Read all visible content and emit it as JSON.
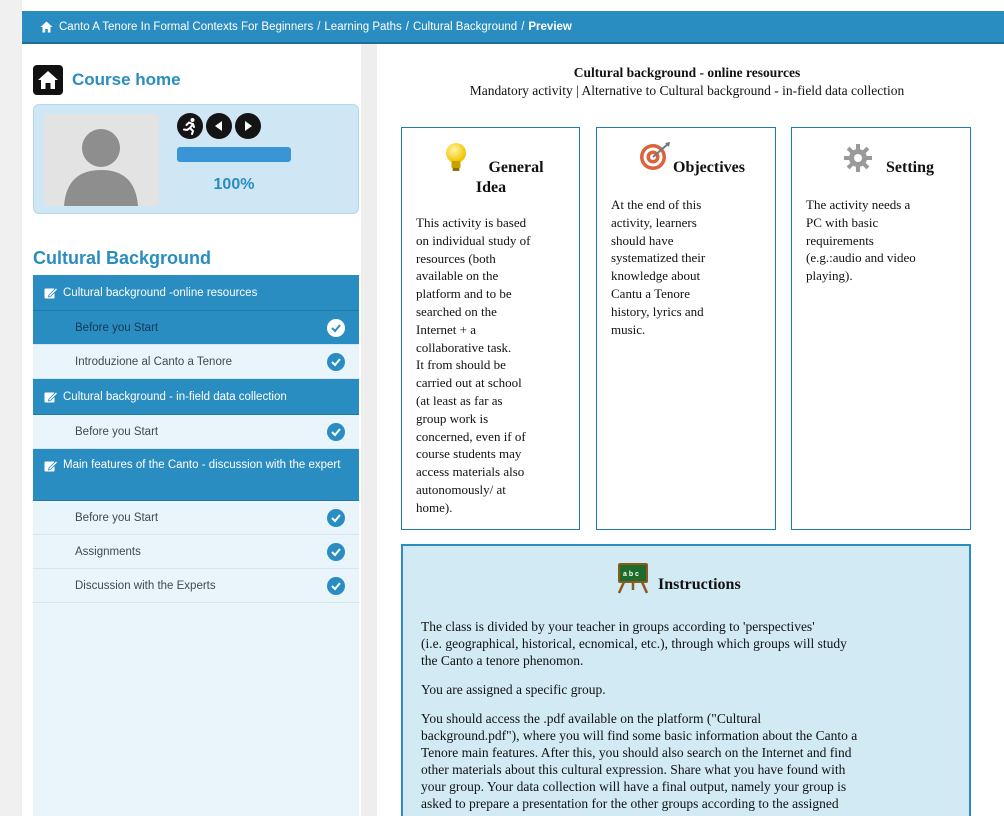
{
  "breadcrumb": {
    "items": [
      "Canto A Tenore In Formal Contexts For Beginners",
      "Learning Paths",
      "Cultural Background"
    ],
    "separator": "/",
    "current": "Preview"
  },
  "sidebar": {
    "course_home": "Course home",
    "progress": {
      "percent_label": "100%",
      "fraction": 1.0
    },
    "section_title": "Cultural Background",
    "groups": [
      {
        "title": "Cultural background -online resources",
        "items": [
          {
            "label": "Before you Start",
            "active": true,
            "completed": true
          },
          {
            "label": "Introduzione al Canto a Tenore",
            "active": false,
            "completed": true
          }
        ]
      },
      {
        "title": "Cultural background - in-field data collection",
        "items": [
          {
            "label": "Before you Start",
            "active": false,
            "completed": true
          }
        ]
      },
      {
        "title": "Main features of the Canto - discussion with the expert",
        "items": [
          {
            "label": "Before you Start",
            "active": false,
            "completed": true
          },
          {
            "label": "Assignments",
            "active": false,
            "completed": true
          },
          {
            "label": "Discussion with the Experts",
            "active": false,
            "completed": true
          }
        ]
      }
    ]
  },
  "activity": {
    "title": "Cultural background - online resources",
    "subtitle": "Mandatory activity | Alternative to Cultural background - in-field data collection"
  },
  "cards": {
    "idea": {
      "icon": "lightbulb-icon",
      "title_line1": "General",
      "title_line2": "Idea",
      "lines": [
        "This activity is based",
        "on individual study of",
        "resources (both",
        "available on the",
        "platform and to be",
        "searched on the",
        "Internet + a",
        "collaborative task.",
        "It from should be",
        "carried out at school",
        "(at least as far as",
        "group work is",
        "concerned, even if of",
        "course students may",
        "access materials also",
        "autonomously/ at",
        "home)."
      ]
    },
    "objectives": {
      "icon": "target-icon",
      "title": "Objectives",
      "lines": [
        "At the end of this",
        "activity, learners",
        "should have",
        "systematized their",
        "knowledge about",
        "Cantu a Tenore",
        "history, lyrics and",
        "music."
      ]
    },
    "setting": {
      "icon": "gear-icon",
      "title": "Setting",
      "lines": [
        "The activity needs a",
        "PC with basic",
        "requirements",
        "(e.g.:audio and video",
        "playing)."
      ]
    }
  },
  "instructions": {
    "icon": "blackboard-icon",
    "title": "Instructions",
    "paragraphs": [
      [
        "The class is divided by your teacher in groups according to 'perspectives'",
        "(i.e. geographical, historical, ecnomical, etc.), through which groups will study",
        "the Canto a tenore phenomon."
      ],
      [
        "You are assigned a specific group."
      ],
      [
        "You should access the .pdf available on the platform (\"Cultural",
        "background.pdf\"), where you will find some basic information about the Canto a",
        "Tenore main features. After this, you should also search on the Internet and find",
        "other materials about this cultural expression. Share what you have found with",
        "your group. Your data collection will have a final output, namely your group is",
        "asked to prepare a presentation for the other groups according to the assigned"
      ]
    ]
  },
  "colors": {
    "accent": "#2a8dc1",
    "sidebar_item_bg": "#eaf5fb",
    "instructions_bg": "#d2eaf4",
    "profile_bg": "#cfe7f5"
  }
}
